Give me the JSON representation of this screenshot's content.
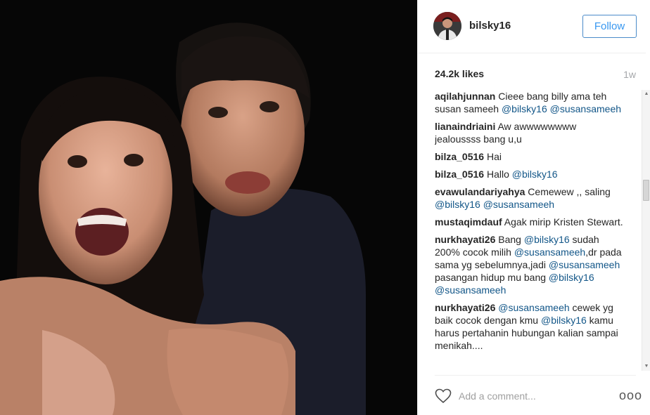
{
  "post": {
    "username": "bilsky16",
    "follow_label": "Follow",
    "likes": "24.2k likes",
    "time": "1w",
    "comment_placeholder": "Add a comment...",
    "more_label": "ooo"
  },
  "comments": [
    {
      "author": "aqilahjunnan",
      "parts": [
        {
          "t": "text",
          "v": " Cieee bang billy ama teh susan sameeh "
        },
        {
          "t": "mention",
          "v": "@bilsky16"
        },
        {
          "t": "text",
          "v": " "
        },
        {
          "t": "mention",
          "v": "@susansameeh"
        }
      ]
    },
    {
      "author": "lianaindriaini",
      "parts": [
        {
          "t": "text",
          "v": " Aw awwwwwwww jealoussss bang u,u"
        }
      ]
    },
    {
      "author": "bilza_0516",
      "parts": [
        {
          "t": "text",
          "v": " Hai"
        }
      ]
    },
    {
      "author": "bilza_0516",
      "parts": [
        {
          "t": "text",
          "v": " Hallo "
        },
        {
          "t": "mention",
          "v": "@bilsky16"
        }
      ]
    },
    {
      "author": "evawulandariyahya",
      "parts": [
        {
          "t": "text",
          "v": " Cemewew ,, saling "
        },
        {
          "t": "mention",
          "v": "@bilsky16"
        },
        {
          "t": "text",
          "v": " "
        },
        {
          "t": "mention",
          "v": "@susansameeh"
        }
      ]
    },
    {
      "author": "mustaqimdauf",
      "parts": [
        {
          "t": "text",
          "v": " Agak mirip Kristen Stewart."
        }
      ]
    },
    {
      "author": "nurkhayati26",
      "parts": [
        {
          "t": "text",
          "v": " Bang "
        },
        {
          "t": "mention",
          "v": "@bilsky16"
        },
        {
          "t": "text",
          "v": " sudah 200% cocok milih "
        },
        {
          "t": "mention",
          "v": "@susansameeh"
        },
        {
          "t": "text",
          "v": ",dr pada sama yg sebelumnya,jadi "
        },
        {
          "t": "mention",
          "v": "@susansameeh"
        },
        {
          "t": "text",
          "v": " pasangan hidup mu bang "
        },
        {
          "t": "mention",
          "v": "@bilsky16"
        },
        {
          "t": "text",
          "v": " "
        },
        {
          "t": "mention",
          "v": "@susansameeh"
        }
      ]
    },
    {
      "author": "nurkhayati26",
      "parts": [
        {
          "t": "text",
          "v": " "
        },
        {
          "t": "mention",
          "v": "@susansameeh"
        },
        {
          "t": "text",
          "v": " cewek yg baik cocok dengan kmu "
        },
        {
          "t": "mention",
          "v": "@bilsky16"
        },
        {
          "t": "text",
          "v": " kamu harus pertahanin hubungan kalian sampai menikah...."
        }
      ]
    }
  ],
  "icons": {
    "like": "heart-icon",
    "more": "more-options-icon",
    "scroll_up": "scroll-up-arrow-icon",
    "scroll_down": "scroll-down-arrow-icon"
  },
  "colors": {
    "follow_border": "#4a8bc9",
    "follow_text": "#3897f0",
    "mention": "#125688",
    "muted": "#a5a7aa"
  }
}
